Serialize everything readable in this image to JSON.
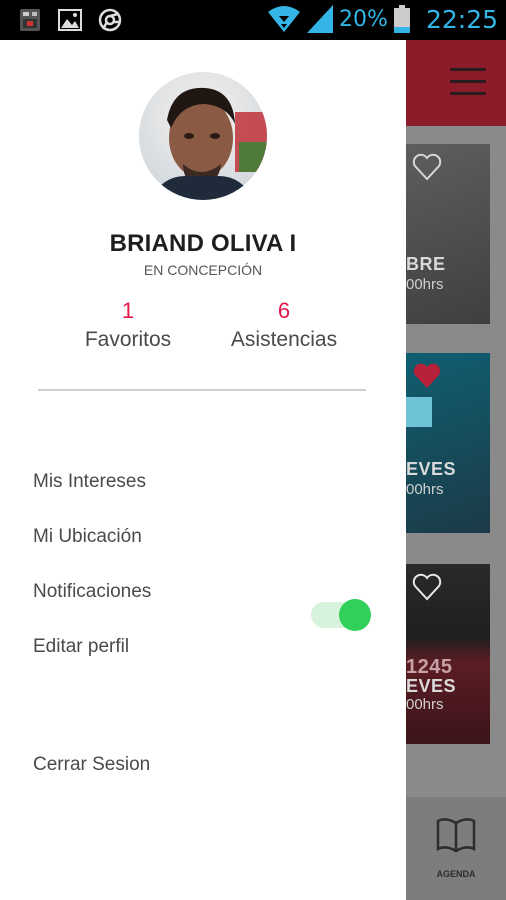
{
  "status_bar": {
    "battery_pct": "20%",
    "time": "22:25",
    "icons": [
      "sim-card-icon",
      "image-icon",
      "chrome-icon",
      "wifi-icon",
      "signal-icon",
      "battery-icon"
    ]
  },
  "profile": {
    "name": "BRIAND OLIVA I",
    "location": "EN CONCEPCIÓN",
    "favorites_count": "1",
    "favorites_label": "Favoritos",
    "attendances_count": "6",
    "attendances_label": "Asistencias"
  },
  "menu": {
    "items": [
      {
        "label": "Mis Intereses"
      },
      {
        "label": "Mi Ubicación"
      },
      {
        "label": "Notificaciones"
      },
      {
        "label": "Editar perfil"
      },
      {
        "label": "Cerrar Sesion"
      }
    ],
    "notifications_enabled": true
  },
  "background": {
    "cards": [
      {
        "word": "BRE",
        "sub": "00hrs"
      },
      {
        "word": "EVES",
        "sub": "00hrs"
      },
      {
        "number": "1245",
        "word": "EVES",
        "sub": "00hrs"
      }
    ],
    "tab_label": "AGENDA"
  },
  "colors": {
    "accent_red": "#e4184a",
    "toggle_green": "#2fd15a",
    "status_blue": "#33b5e5"
  }
}
